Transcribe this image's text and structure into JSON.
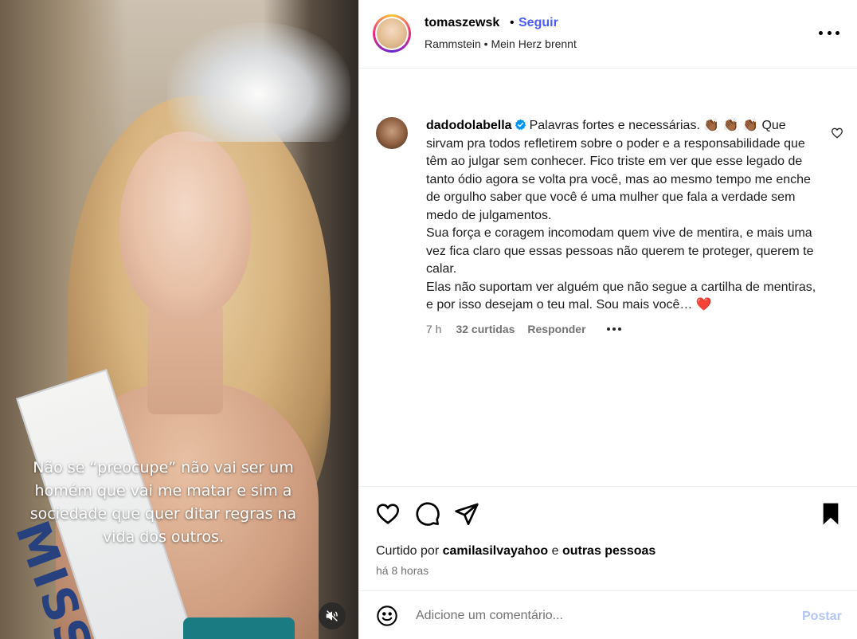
{
  "media": {
    "caption": "Não se “preocupe” não vai ser um homém que vai me matar e sim a sociedade que quer ditar regras na vida dos outros.",
    "sash_text": "MISS"
  },
  "header": {
    "username": "tomaszewsk",
    "separator": "•",
    "follow_label": "Seguir",
    "audio": "Rammstein • Mein Herz brennt"
  },
  "comment": {
    "username": "dadodolabella",
    "text_line1": "Palavras fortes e necessárias. 👏🏾 👏🏾 👏🏾 Que",
    "text_rest": "sirvam pra todos refletirem sobre o poder e a responsabilidade que têm ao julgar sem conhecer. Fico triste em ver que esse legado de tanto ódio agora se volta pra você, mas ao mesmo tempo me enche de orgulho saber que você é uma mulher que fala a verdade sem medo de julgamentos.",
    "text_p2": "Sua força e coragem incomodam quem vive de mentira, e mais uma vez fica claro que essas pessoas não querem te proteger, querem te calar.",
    "text_p3": "Elas não suportam ver alguém que não segue a cartilha de mentiras, e por isso desejam o teu mal. Sou mais você… ❤️",
    "time": "7 h",
    "likes": "32 curtidas",
    "reply_label": "Responder"
  },
  "actions": {
    "liked_by_prefix": "Curtido por",
    "liked_by_user": "camilasilvayahoo",
    "liked_by_and": "e",
    "liked_by_others": "outras pessoas",
    "time_ago": "há 8 horas"
  },
  "composer": {
    "placeholder": "Adicione um comentário...",
    "post_label": "Postar"
  },
  "colors": {
    "accent": "#4a5df9",
    "post_disabled": "#b3c5f5",
    "verified": "#0095f6"
  }
}
